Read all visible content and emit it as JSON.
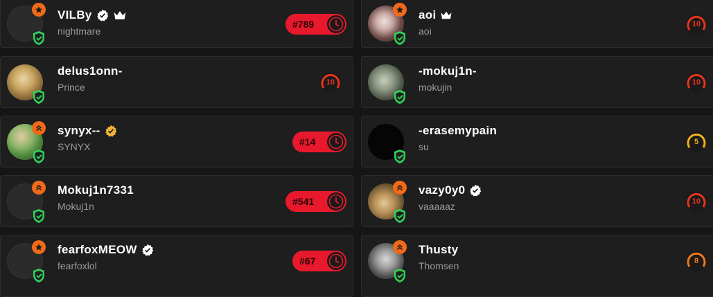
{
  "colors": {
    "background": "#161616",
    "card": "#1e1e1e",
    "rank_pill": "#e8192c",
    "level_red": "#e8341c",
    "level_gold": "#f2b11a",
    "level_orange": "#f0781a",
    "shield_green": "#2fd15a",
    "badge_orange": "#f06a1a",
    "verified_white": "#ffffff",
    "verified_gold": "#f2b437"
  },
  "left_column": [
    {
      "name": "VILBy",
      "sub": "nightmare",
      "rank": "#789",
      "icons": [
        "verified-white-icon",
        "crown-icon"
      ],
      "corner": "star-icon"
    },
    {
      "name": "delus1onn-",
      "sub": "Prince",
      "level": "10",
      "icons": [],
      "corner": null
    },
    {
      "name": "synyx--",
      "sub": "SYNYX",
      "rank": "#14",
      "icons": [
        "verified-gold-icon"
      ],
      "corner": "chevrons-up-icon"
    },
    {
      "name": "Mokuj1n7331",
      "sub": "Mokuj1n",
      "rank": "#541",
      "icons": [],
      "corner": "chevrons-up-icon"
    },
    {
      "name": "fearfoxMEOW",
      "sub": "fearfoxlol",
      "rank": "#67",
      "icons": [
        "verified-white-icon"
      ],
      "corner": "star-icon"
    }
  ],
  "right_column": [
    {
      "name": "aoi",
      "sub": "aoi",
      "level": "10",
      "icons": [
        "crown-icon"
      ],
      "corner": "star-icon"
    },
    {
      "name": "-mokuj1n-",
      "sub": "mokujin",
      "level": "10",
      "icons": [],
      "corner": null
    },
    {
      "name": "-erasemypain",
      "sub": "su",
      "level": "5",
      "icons": [],
      "corner": null
    },
    {
      "name": "vazy0y0",
      "sub": "vaaaaaz",
      "level": "10",
      "icons": [
        "verified-white-icon"
      ],
      "corner": "chevrons-up-icon"
    },
    {
      "name": "Thusty",
      "sub": "Thomsen",
      "level": "8",
      "icons": [],
      "corner": "chevrons-up-icon"
    }
  ]
}
